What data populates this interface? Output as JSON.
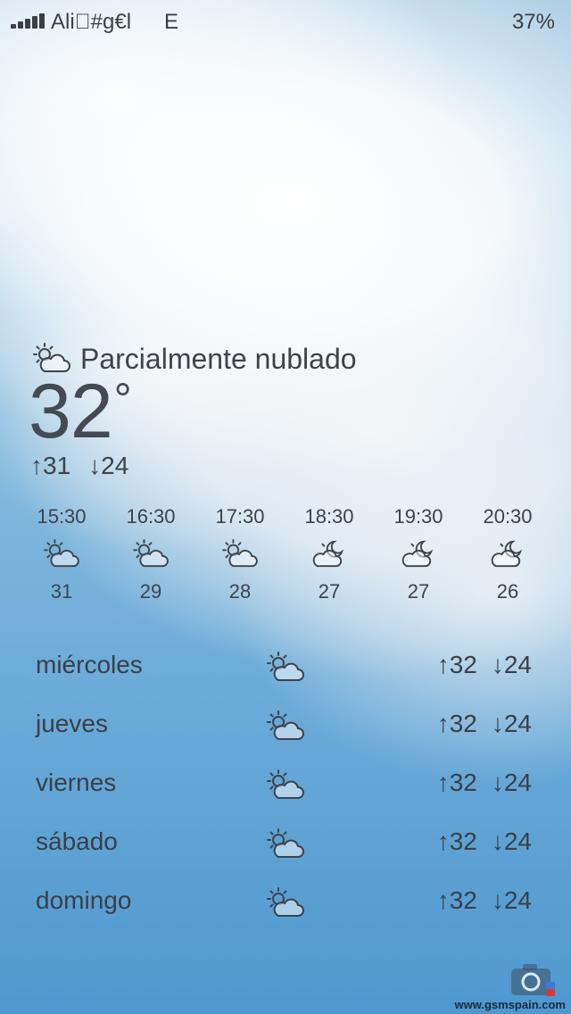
{
  "status": {
    "carrier": "Ali#g€l",
    "network": "E",
    "battery": "37%"
  },
  "current": {
    "icon": "partly-cloudy-day-icon",
    "condition": "Parcialmente nublado",
    "temp": "32",
    "degree": "°",
    "high": "↑31",
    "low": "↓24"
  },
  "hourly": [
    {
      "time": "15:30",
      "icon": "partly-cloudy-day-icon",
      "temp": "31"
    },
    {
      "time": "16:30",
      "icon": "partly-cloudy-day-icon",
      "temp": "29"
    },
    {
      "time": "17:30",
      "icon": "partly-cloudy-day-icon",
      "temp": "28"
    },
    {
      "time": "18:30",
      "icon": "partly-cloudy-night-icon",
      "temp": "27"
    },
    {
      "time": "19:30",
      "icon": "partly-cloudy-night-icon",
      "temp": "27"
    },
    {
      "time": "20:30",
      "icon": "partly-cloudy-night-icon",
      "temp": "26"
    }
  ],
  "daily": [
    {
      "day": "miércoles",
      "icon": "partly-cloudy-day-icon",
      "high": "↑32",
      "low": "↓24"
    },
    {
      "day": "jueves",
      "icon": "partly-cloudy-day-icon",
      "high": "↑32",
      "low": "↓24"
    },
    {
      "day": "viernes",
      "icon": "partly-cloudy-day-icon",
      "high": "↑32",
      "low": "↓24"
    },
    {
      "day": "sábado",
      "icon": "partly-cloudy-day-icon",
      "high": "↑32",
      "low": "↓24"
    },
    {
      "day": "domingo",
      "icon": "partly-cloudy-day-icon",
      "high": "↑32",
      "low": "↓24"
    }
  ],
  "watermark": "www.gsmspain.com",
  "colors": {
    "text": "#3a3f47",
    "sky_top": "#a9cce3",
    "sky_bottom": "#4f98cf"
  }
}
